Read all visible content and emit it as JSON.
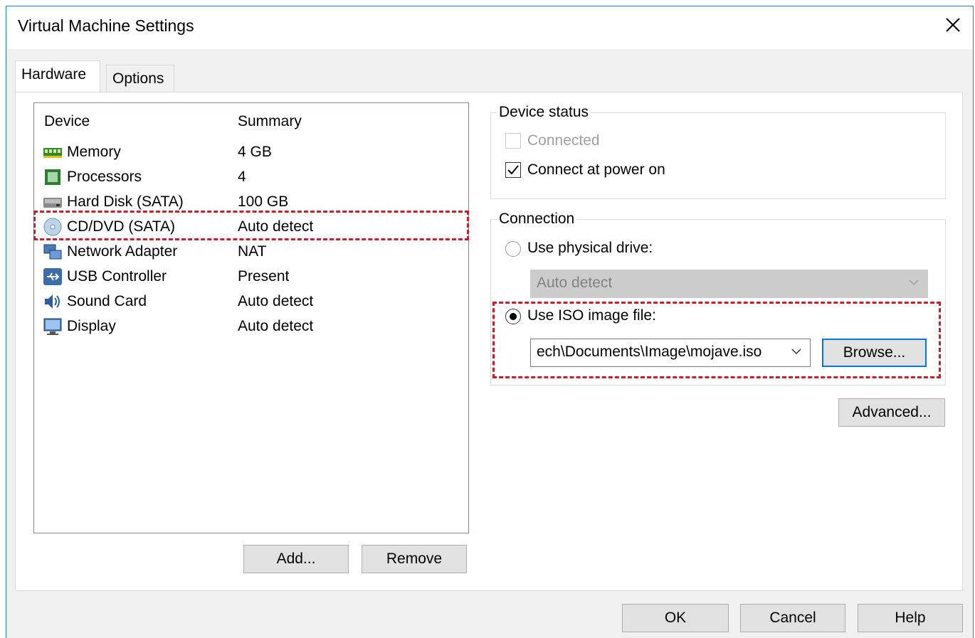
{
  "window": {
    "title": "Virtual Machine Settings"
  },
  "tabs": [
    {
      "label": "Hardware",
      "active": true
    },
    {
      "label": "Options",
      "active": false
    }
  ],
  "device_list": {
    "columns": [
      "Device",
      "Summary"
    ],
    "rows": [
      {
        "name": "Memory",
        "summary": "4 GB",
        "icon": "memory-icon"
      },
      {
        "name": "Processors",
        "summary": "4",
        "icon": "processor-icon"
      },
      {
        "name": "Hard Disk (SATA)",
        "summary": "100 GB",
        "icon": "hard-disk-icon"
      },
      {
        "name": "CD/DVD (SATA)",
        "summary": "Auto detect",
        "icon": "cd-dvd-icon",
        "selected": true
      },
      {
        "name": "Network Adapter",
        "summary": "NAT",
        "icon": "network-adapter-icon"
      },
      {
        "name": "USB Controller",
        "summary": "Present",
        "icon": "usb-icon"
      },
      {
        "name": "Sound Card",
        "summary": "Auto detect",
        "icon": "sound-card-icon"
      },
      {
        "name": "Display",
        "summary": "Auto detect",
        "icon": "display-icon"
      }
    ]
  },
  "device_buttons": {
    "add": "Add...",
    "remove": "Remove"
  },
  "device_status": {
    "label": "Device status",
    "connected": {
      "label": "Connected",
      "checked": false,
      "enabled": false
    },
    "connect_at_power_on": {
      "label": "Connect at power on",
      "checked": true,
      "enabled": true
    }
  },
  "connection": {
    "label": "Connection",
    "physical": {
      "label": "Use physical drive:",
      "selected": false,
      "value": "Auto detect"
    },
    "iso": {
      "label": "Use ISO image file:",
      "selected": true,
      "value": "ech\\Documents\\Image\\mojave.iso",
      "browse": "Browse..."
    }
  },
  "advanced_label": "Advanced...",
  "footer": {
    "ok": "OK",
    "cancel": "Cancel",
    "help": "Help"
  },
  "colors": {
    "accent": "#0078d7",
    "highlight": "#c8202b"
  }
}
